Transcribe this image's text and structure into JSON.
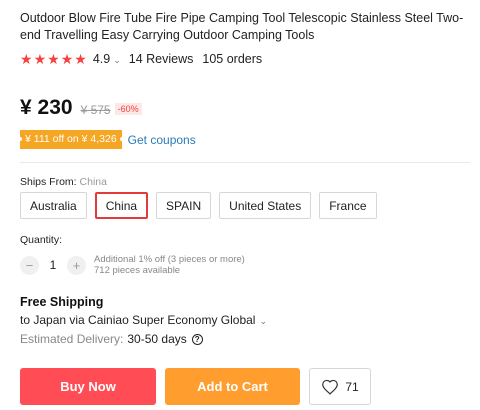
{
  "product": {
    "title": "Outdoor Blow Fire Tube Fire Pipe Camping Tool Telescopic Stainless Steel Two-end Travelling Easy Carrying Outdoor Camping Tools"
  },
  "rating": {
    "stars": 5,
    "value": "4.9",
    "reviews": "14 Reviews",
    "orders": "105 orders"
  },
  "pricing": {
    "price": "¥ 230",
    "original_price": "¥ 575",
    "discount": "-60%",
    "coupon": "¥ 111 off on ¥ 4,326",
    "coupon_link": "Get coupons"
  },
  "shipping_from": {
    "label": "Ships From:",
    "value": "China",
    "options": [
      "Australia",
      "China",
      "SPAIN",
      "United States",
      "France"
    ],
    "selected": "China"
  },
  "quantity": {
    "label": "Quantity:",
    "minus": "−",
    "value": "1",
    "plus": "+",
    "additional": "Additional 1% off (3 pieces or more)",
    "available": "712 pieces available"
  },
  "delivery": {
    "title": "Free Shipping",
    "destination": "to Japan via Cainiao Super Economy Global",
    "estimated_label": "Estimated Delivery:",
    "estimated_days": "30-50 days",
    "help": "?"
  },
  "actions": {
    "buy_now": "Buy Now",
    "add_to_cart": "Add to Cart",
    "wishlist_count": "71"
  },
  "colors": {
    "star": "#f5413f",
    "buy_now": "#ff4c55",
    "add_to_cart": "#ff9d2e",
    "coupon_bg": "#f5a623",
    "link": "#2a7ab8",
    "selected_border": "#e33b3b"
  },
  "icons": [
    "star-icon",
    "chevron-down-icon",
    "help-icon",
    "heart-icon"
  ]
}
